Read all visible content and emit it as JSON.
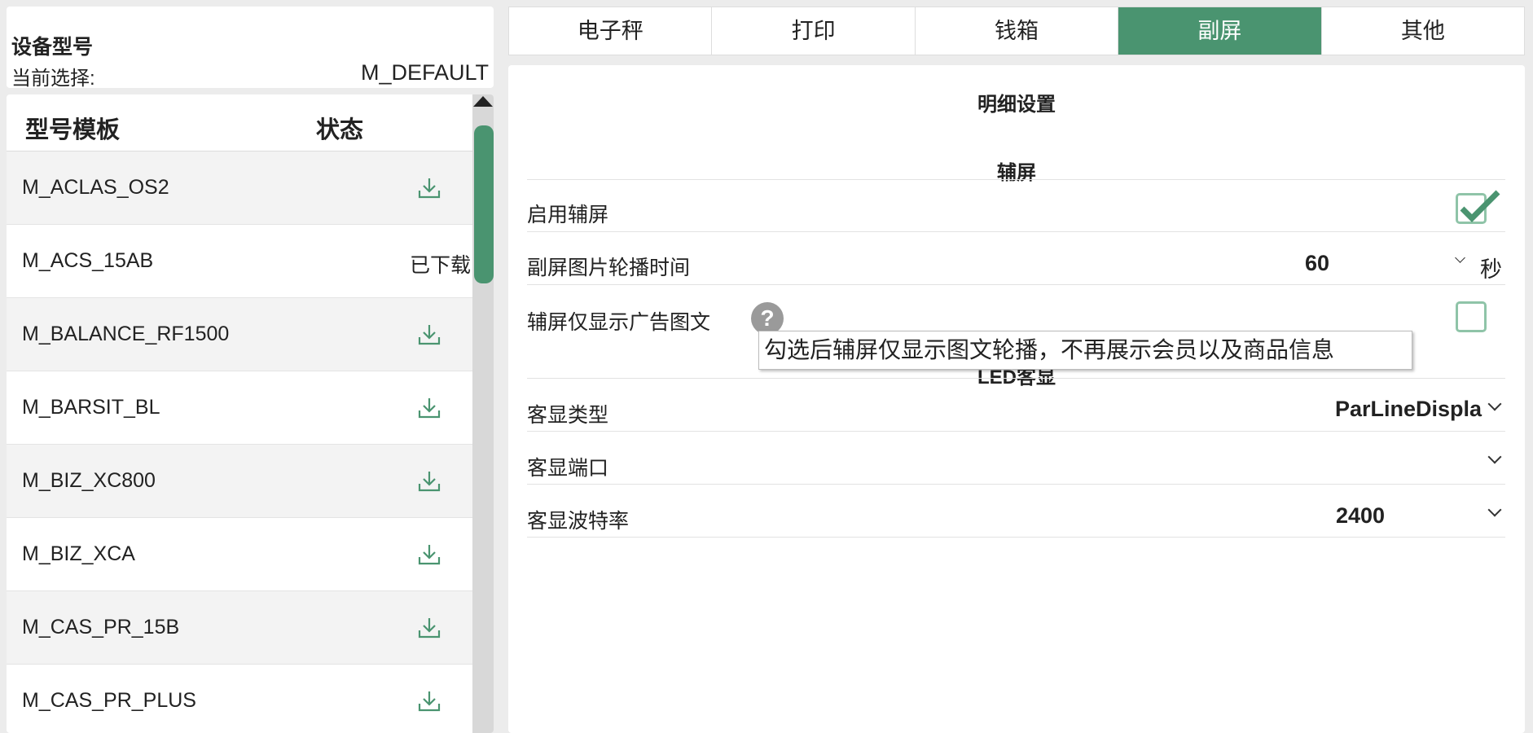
{
  "device": {
    "title": "设备型号",
    "current_label": "当前选择:",
    "current_value": "M_DEFAULT"
  },
  "list": {
    "col_model": "型号模板",
    "col_status": "状态",
    "rows": [
      {
        "name": "M_ACLAS_OS2",
        "status": "download-icon"
      },
      {
        "name": "M_ACS_15AB",
        "status": "已下载"
      },
      {
        "name": "M_BALANCE_RF1500",
        "status": "download-icon"
      },
      {
        "name": "M_BARSIT_BL",
        "status": "download-icon"
      },
      {
        "name": "M_BIZ_XC800",
        "status": "download-icon"
      },
      {
        "name": "M_BIZ_XCA",
        "status": "download-icon"
      },
      {
        "name": "M_CAS_PR_15B",
        "status": "download-icon"
      },
      {
        "name": "M_CAS_PR_PLUS",
        "status": "download-icon"
      }
    ]
  },
  "tabs": [
    "电子秤",
    "打印",
    "钱箱",
    "副屏",
    "其他"
  ],
  "active_tab": "副屏",
  "main": {
    "title": "明细设置",
    "section1": "辅屏",
    "section2": "LED客显",
    "enable_label": "启用辅屏",
    "enable_checked": true,
    "interval_label": "副屏图片轮播时间",
    "interval_value": "60",
    "interval_unit": "秒",
    "ad_only_label": "辅屏仅显示广告图文",
    "ad_only_checked": false,
    "tooltip": "勾选后辅屏仅显示图文轮播，不再展示会员以及商品信息",
    "disp_type_label": "客显类型",
    "disp_type_value": "ParLineDispla",
    "disp_port_label": "客显端口",
    "disp_port_value": "",
    "baud_label": "客显波特率",
    "baud_value": "2400"
  },
  "colors": {
    "accent": "#4a9470"
  }
}
